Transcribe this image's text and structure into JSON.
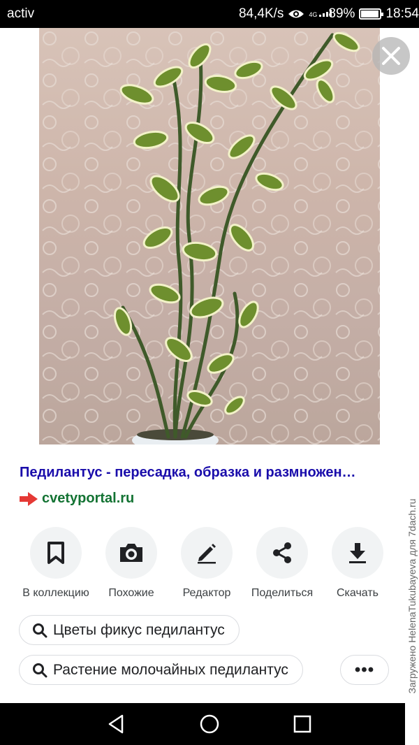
{
  "status_bar": {
    "carrier": "activ",
    "speed": "84,4K/s",
    "network": "4G",
    "battery": "89%",
    "time": "18:54",
    "battery_level": 0.89
  },
  "viewer": {
    "image_subject": "pedilanthus-plant-photo"
  },
  "result": {
    "title": "Педилантус - пересадка, образка и размножен…",
    "source_domain": "cvetyportal.ru"
  },
  "actions": [
    {
      "label": "В коллекцию",
      "icon": "bookmark-icon"
    },
    {
      "label": "Похожие",
      "icon": "camera-icon"
    },
    {
      "label": "Редактор",
      "icon": "pencil-icon"
    },
    {
      "label": "Поделиться",
      "icon": "share-icon"
    },
    {
      "label": "Скачать",
      "icon": "download-icon"
    }
  ],
  "related_searches": [
    {
      "label": "Цветы фикус педилантус"
    },
    {
      "label": "Растение молочайных педилантус"
    }
  ],
  "more_label": "•••",
  "watermark": "Загружено HelenaTukubayeva для 7dach.ru",
  "colors": {
    "title_link": "#1a0dab",
    "domain": "#137333",
    "source_arrow": "#e53935",
    "chip_border": "#dadce0",
    "action_circle": "#f1f3f4"
  }
}
